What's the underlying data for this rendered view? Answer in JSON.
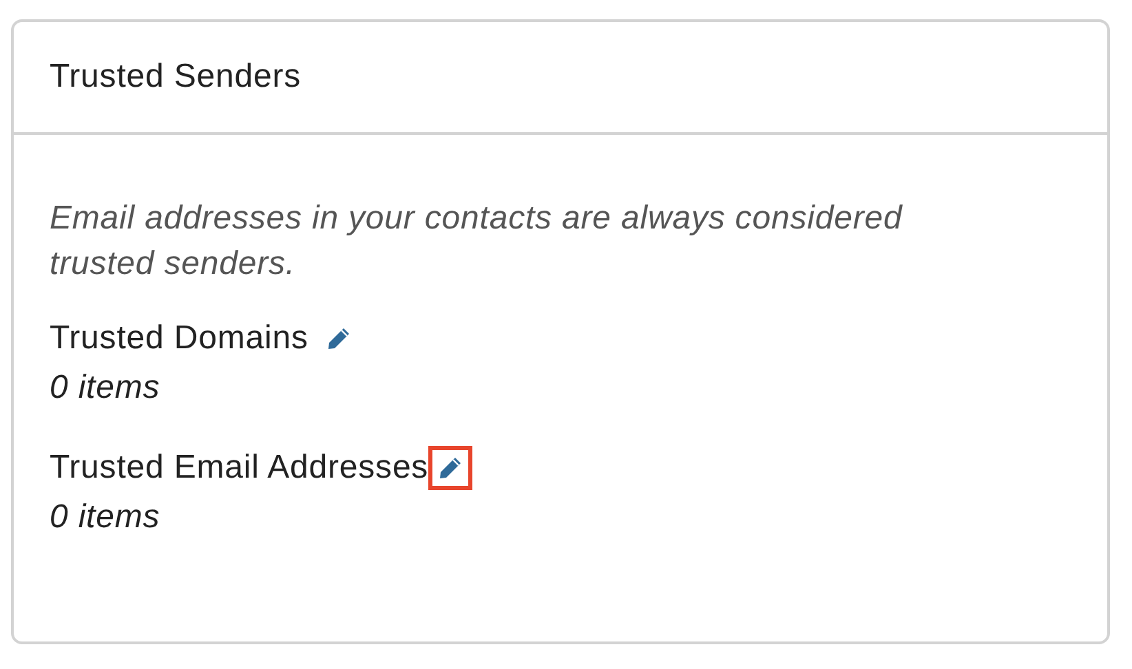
{
  "panel": {
    "title": "Trusted Senders",
    "note": "Email addresses in your contacts are always considered trusted senders.",
    "lists": [
      {
        "label": "Trusted Domains",
        "count": "0 items",
        "highlighted": false
      },
      {
        "label": "Trusted Email Addresses",
        "count": "0 items",
        "highlighted": true
      }
    ]
  }
}
